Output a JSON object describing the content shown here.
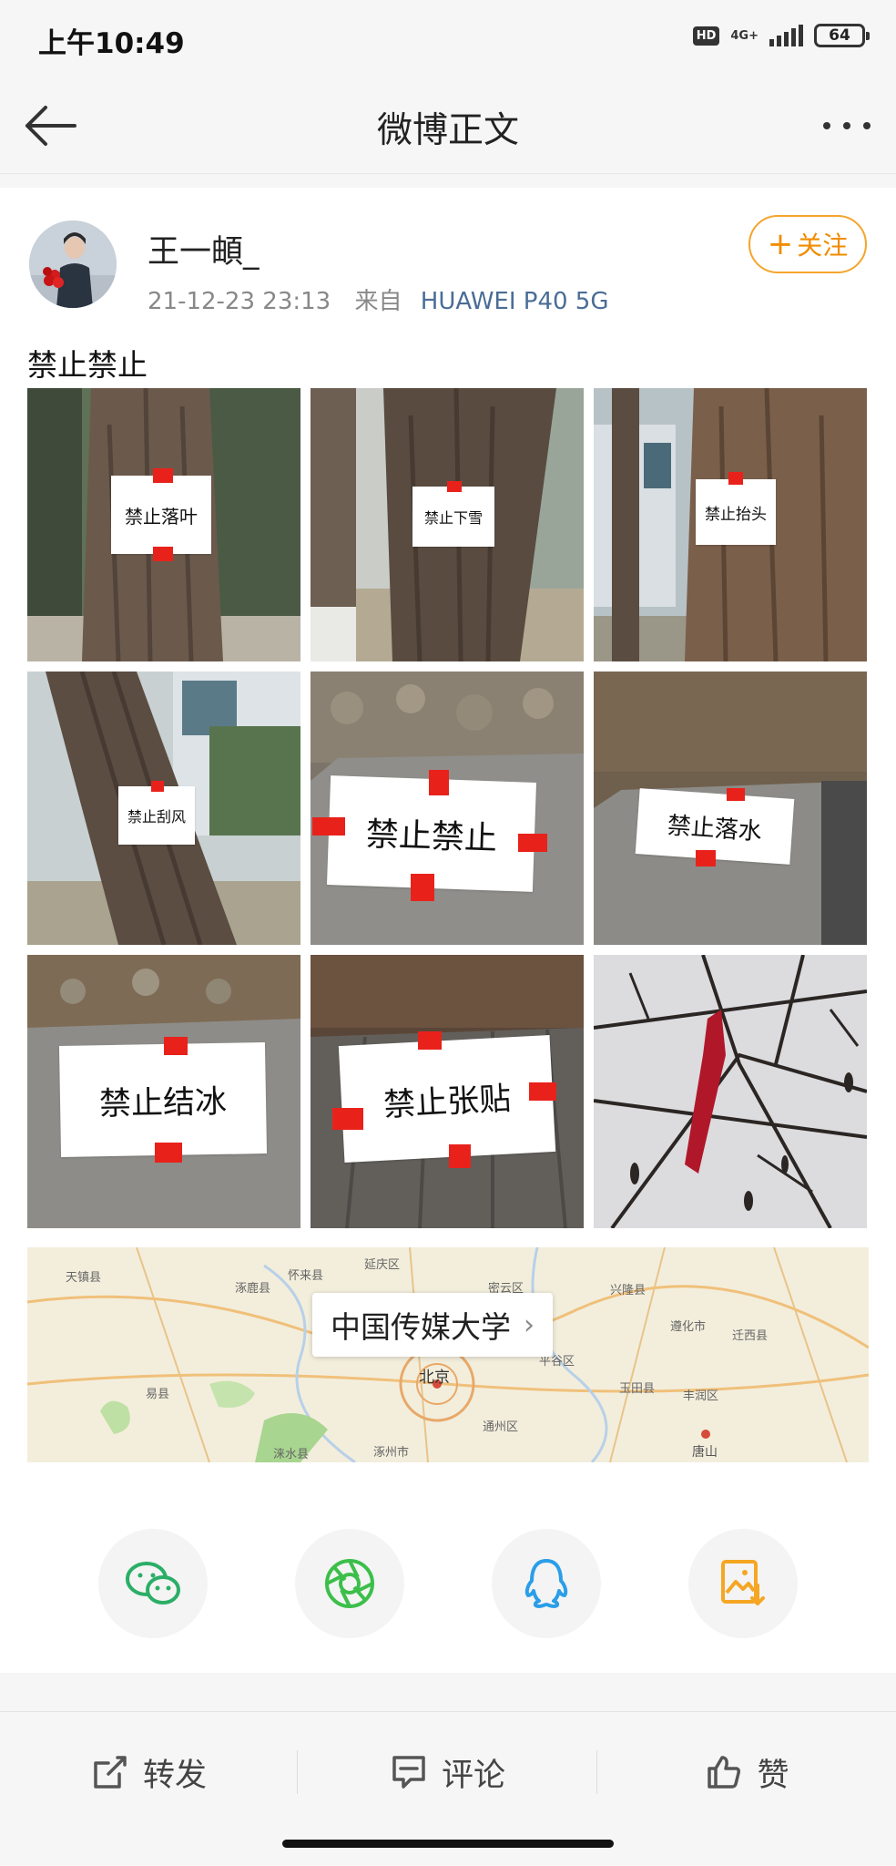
{
  "status_bar": {
    "time": "上午10:49",
    "hd": "HD",
    "network": "4G+",
    "battery": "64"
  },
  "nav": {
    "title": "微博正文"
  },
  "post": {
    "author": "王一頔_",
    "timestamp": "21-12-23 23:13",
    "source_prefix": "来自",
    "device": "HUAWEI P40 5G",
    "follow_label": "关注",
    "text": "禁止禁止",
    "images": [
      {
        "sign": "禁止落叶"
      },
      {
        "sign": "禁止下雪"
      },
      {
        "sign": "禁止抬头"
      },
      {
        "sign": "禁止刮风"
      },
      {
        "sign": "禁止禁止"
      },
      {
        "sign": "禁止落水"
      },
      {
        "sign": "禁止结冰"
      },
      {
        "sign": "禁止张贴"
      },
      {
        "sign": ""
      }
    ],
    "location": "中国传媒大学",
    "map_labels": [
      "北京",
      "唐山",
      "天镇县",
      "涿鹿县",
      "怀来县",
      "延庆区",
      "密云区",
      "兴隆县",
      "遵化市",
      "迁西县",
      "平谷区",
      "通州区",
      "玉田县",
      "丰润区",
      "涞水县",
      "涿州市",
      "易县"
    ]
  },
  "share": [
    {
      "name": "wechat",
      "icon": "wechat-icon",
      "color": "#2bae67"
    },
    {
      "name": "moments",
      "icon": "moments-icon",
      "color": "#3cbf4a"
    },
    {
      "name": "qq",
      "icon": "qq-icon",
      "color": "#2a9ee8"
    },
    {
      "name": "save-image",
      "icon": "save-image-icon",
      "color": "#f5a623"
    }
  ],
  "toolbar": {
    "repost": "转发",
    "comment": "评论",
    "like": "赞"
  }
}
